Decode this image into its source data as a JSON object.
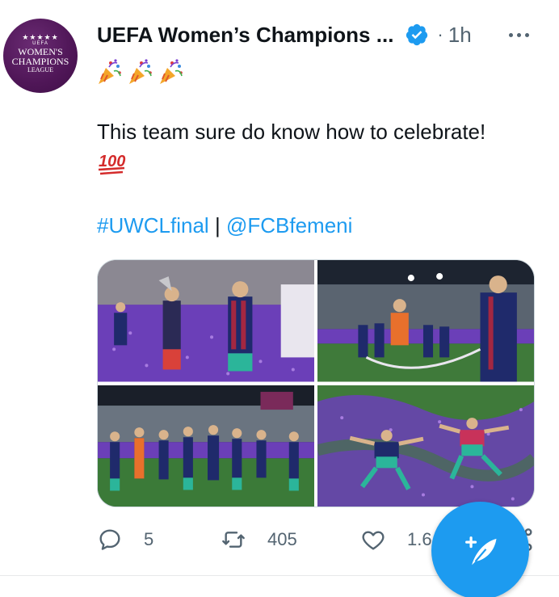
{
  "tweet": {
    "author_name": "UEFA Women’s Champions ...",
    "verified": true,
    "separator": "·",
    "time": "1h",
    "avatar": {
      "stars": "★★★★★",
      "small_text": "UEFA",
      "line1": "WOMEN'S",
      "line2": "CHAMPIONS",
      "line3": "LEAGUE"
    },
    "emojis": [
      "party-popper",
      "party-popper",
      "party-popper"
    ],
    "text": "This team sure do know how to celebrate!",
    "text_emoji": "hundred-points",
    "hashtag": "#UWCLfinal",
    "tag_separator": "|",
    "mention": "@FCBfemeni",
    "media_count": 4,
    "actions": {
      "reply_count": "5",
      "retweet_count": "405",
      "like_count": "1.6"
    }
  },
  "colors": {
    "accent": "#1d9bf0",
    "text": "#0f1419",
    "secondary": "#536471",
    "avatar_bg": "#4f1657",
    "confetti": "#7a3fd0",
    "pitch": "#3f7a3a"
  },
  "icons": {
    "more": "more-dots-icon",
    "reply": "reply-icon",
    "retweet": "retweet-icon",
    "like": "heart-icon",
    "share": "share-icon",
    "compose": "compose-tweet-icon"
  }
}
